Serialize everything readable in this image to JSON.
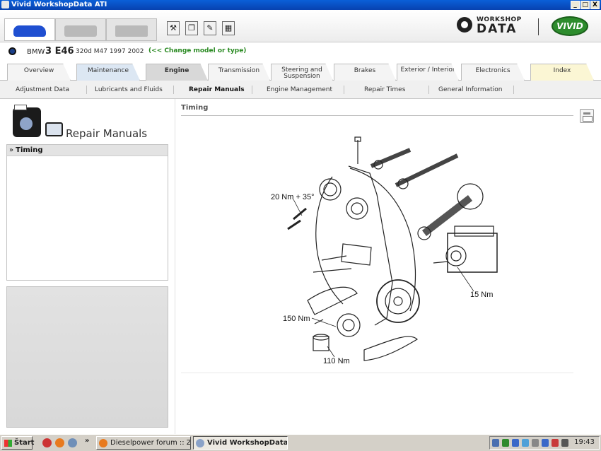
{
  "window": {
    "title": "Vivid WorkshopData ATI",
    "buttons": [
      "_",
      "□",
      "X"
    ]
  },
  "header": {
    "toolbar_icons": [
      "tools-icon",
      "copy-icon",
      "edit-icon",
      "calculator-icon"
    ],
    "toolbar_glyphs": [
      "⚒",
      "❐",
      "✎",
      "▦"
    ],
    "logo_workshop": "WORKSHOP",
    "logo_data": "DATA",
    "logo_vivid": "VIVID",
    "accent_green": "#2d8c2d"
  },
  "vehicle": {
    "make": "BMW",
    "model": "3 E46",
    "variant": "320d M47 1997 2002",
    "change_link": "(<< Change model or type)"
  },
  "main_tabs": [
    {
      "label": "Overview"
    },
    {
      "label": "Maintenance"
    },
    {
      "label": "Engine"
    },
    {
      "label": "Transmission"
    },
    {
      "label": "Steering and Suspension"
    },
    {
      "label": "Brakes"
    },
    {
      "label": "Exterior / Interior"
    },
    {
      "label": "Electronics"
    },
    {
      "label": "Index"
    }
  ],
  "sub_nav": [
    {
      "label": "Adjustment Data"
    },
    {
      "label": "Lubricants and Fluids"
    },
    {
      "label": "Repair Manuals"
    },
    {
      "label": "Engine Management"
    },
    {
      "label": "Repair Times"
    },
    {
      "label": "General Information"
    }
  ],
  "sidebar": {
    "title": "Repair Manuals",
    "items": [
      {
        "label": "Timing",
        "bullet": "»"
      }
    ]
  },
  "content": {
    "title": "Timing",
    "torque_labels": [
      "20 Nm + 35°",
      "15 Nm",
      "150 Nm",
      "110 Nm"
    ]
  },
  "taskbar": {
    "start_label": "Štart",
    "more": "»",
    "windows": [
      {
        "label": "Dieselpower forum :: Zo..."
      },
      {
        "label": "Vivid WorkshopData ..."
      }
    ],
    "clock": "19:43"
  }
}
